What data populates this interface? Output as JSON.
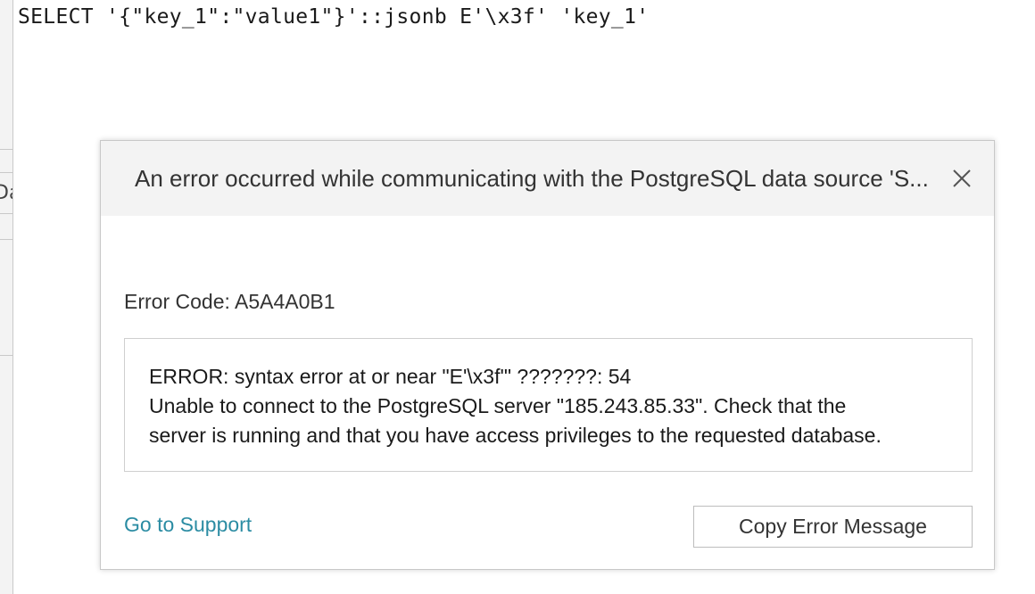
{
  "editor": {
    "sql_text": "SELECT '{\"key_1\":\"value1\"}'::jsonb E'\\x3f' 'key_1'",
    "side_label": "Da"
  },
  "dialog": {
    "title": "An error occurred while communicating with the PostgreSQL data source 'S...",
    "close_icon": "close-icon",
    "error_code": "Error Code: A5A4A0B1",
    "error_lines": [
      "ERROR: syntax error at or near \"E'\\x3f'\" ???????: 54",
      "Unable to connect to the PostgreSQL server \"185.243.85.33\". Check that the",
      "server is running and that you have access privileges to the requested database."
    ],
    "support_link": "Go to Support",
    "copy_button": "Copy Error Message"
  },
  "colors": {
    "link": "#2b8ca3",
    "header_bg": "#f3f3f3",
    "border": "#c8c8c8"
  }
}
